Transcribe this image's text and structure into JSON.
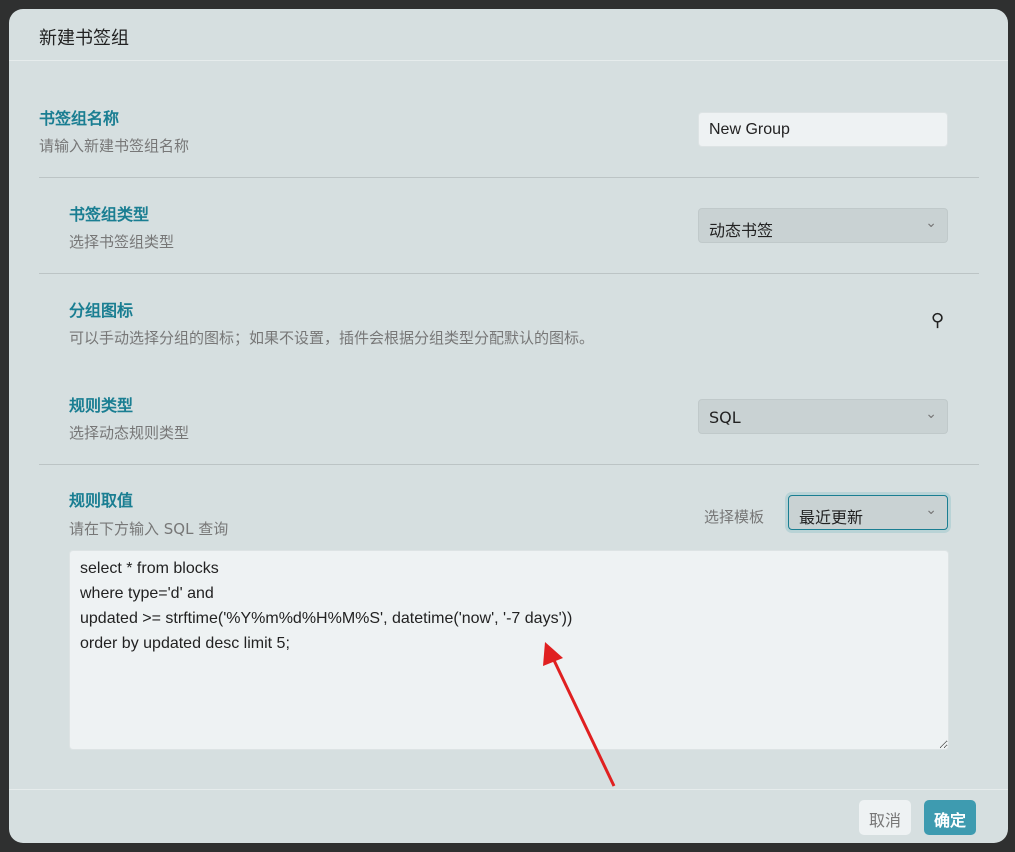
{
  "dialog": {
    "title": "新建书签组"
  },
  "fields": {
    "name": {
      "label": "书签组名称",
      "desc": "请输入新建书签组名称",
      "value": "New Group"
    },
    "type": {
      "label": "书签组类型",
      "desc": "选择书签组类型",
      "value": "动态书签"
    },
    "icon": {
      "label": "分组图标",
      "desc": "可以手动选择分组的图标；如果不设置，插件会根据分组类型分配默认的图标。",
      "icon": "search-icon"
    },
    "rule_type": {
      "label": "规则类型",
      "desc": "选择动态规则类型",
      "value": "SQL"
    },
    "rule_value": {
      "label": "规则取值",
      "desc": "请在下方输入 SQL 查询",
      "template_label": "选择模板",
      "template_value": "最近更新",
      "query": "select * from blocks\nwhere type='d' and\nupdated >= strftime('%Y%m%d%H%M%S', datetime('now', '-7 days'))\norder by updated desc limit 5;"
    }
  },
  "footer": {
    "cancel": "取消",
    "confirm": "确定"
  },
  "colors": {
    "accent": "#1a7e92",
    "confirm_bg": "#3e9bb0",
    "arrow": "#e02020"
  }
}
